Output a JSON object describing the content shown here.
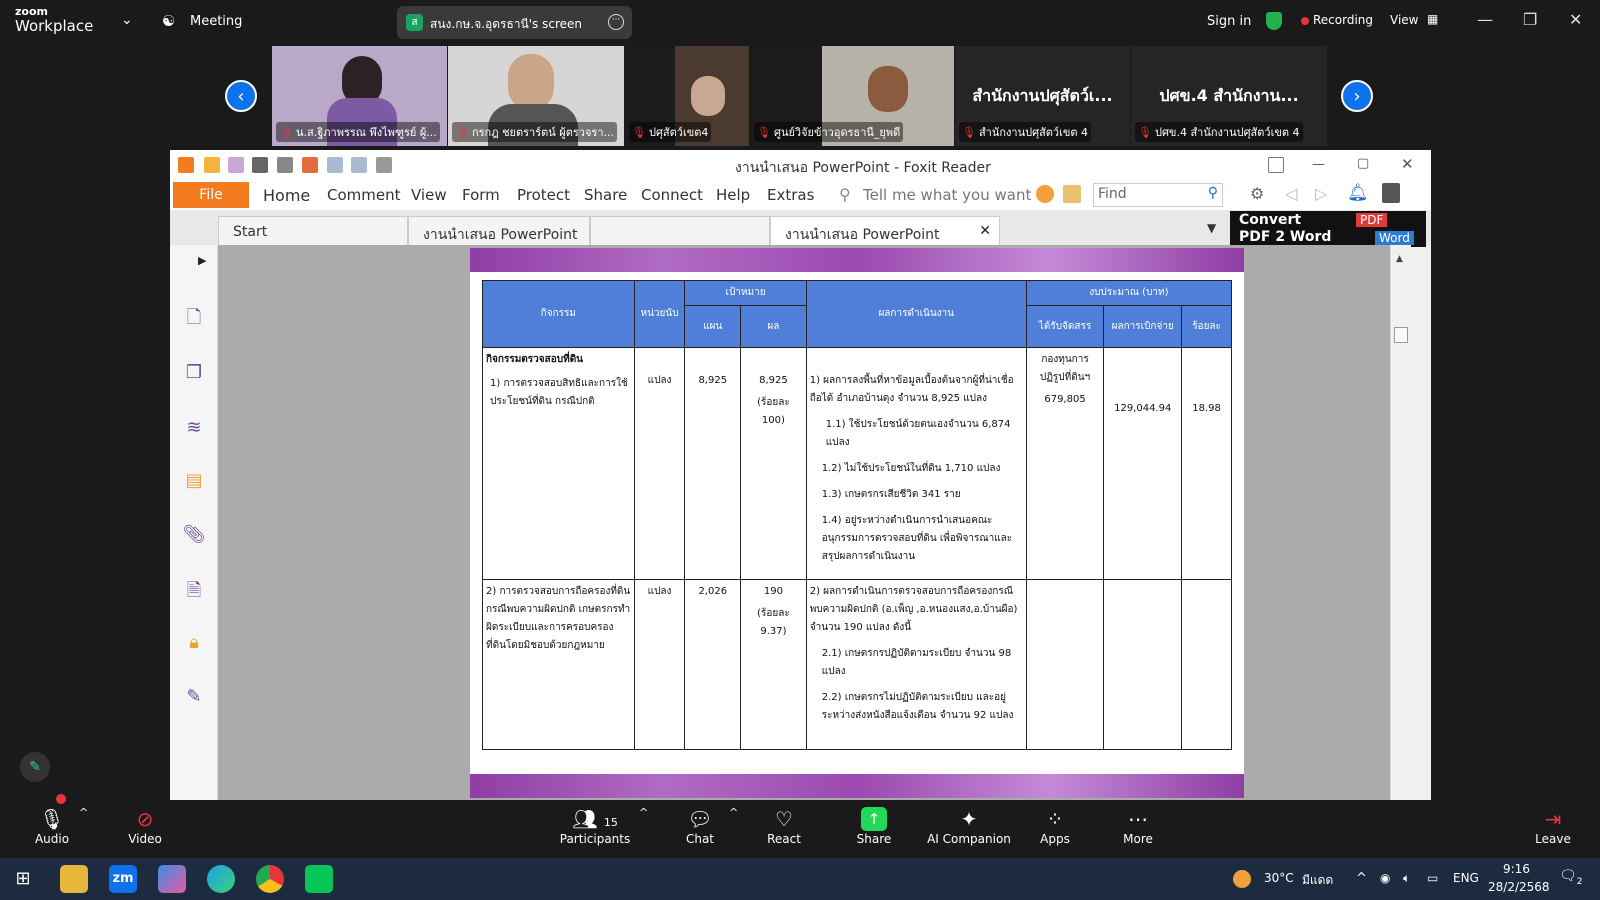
{
  "zoom": {
    "logo_line1": "zoom",
    "logo_line2": "Workplace",
    "meeting_label": "Meeting",
    "share_badge": "ส",
    "share_text": "สนง.กษ.จ.อุดรธานี's screen",
    "sign_in": "Sign in",
    "recording": "Recording",
    "view": "View",
    "participants": [
      {
        "name": "น.ส.ฐิภาพรรณ พึงไพฑูรย์ ผู้...",
        "type": "video"
      },
      {
        "name": "กรกฎ ชยตราร์ตน์ ผู้ตรวจรา...",
        "type": "video"
      },
      {
        "name": "ปศุสัตว์เขต4",
        "type": "video"
      },
      {
        "name": "ศูนย์วิจัยข้าวอุดรธานี_ยุพดี",
        "type": "video"
      },
      {
        "name": "สำนักงานปศุสัตว์เขต 4",
        "display": "สำนักงานปศุสัตว์เ...",
        "type": "text"
      },
      {
        "name": "ปศข.4 สำนักงานปศุสัตว์เขต 4",
        "display": "ปศข.4 สำนักงาน...",
        "type": "text"
      }
    ]
  },
  "foxit": {
    "title": "งานนำเสนอ PowerPoint - Foxit Reader",
    "menu": {
      "file": "File",
      "items": [
        "Home",
        "Comment",
        "View",
        "Form",
        "Protect",
        "Share",
        "Connect",
        "Help",
        "Extras"
      ],
      "tell_me": "Tell me what you want tc",
      "find_placeholder": "Find"
    },
    "tabs": [
      "Start",
      "งานนำเสนอ PowerPoint",
      "",
      "งานนำเสนอ PowerPoint"
    ],
    "convert": {
      "line1": "Convert",
      "line2": "PDF 2 Word",
      "pdf": "PDF",
      "word": "Word"
    }
  },
  "table": {
    "headers": {
      "activity": "กิจกรรม",
      "unit": "หน่วยนับ",
      "target": "เป้าหมาย",
      "plan": "แผน",
      "result": "ผล",
      "performance": "ผลการดำเนินงาน",
      "budget": "งบประมาณ (บาท)",
      "allocated": "ได้รับจัดสรร",
      "disbursed": "ผลการเบิกจ่าย",
      "percent": "ร้อยละ"
    },
    "rows": [
      {
        "section": "กิจกรรมตรวจสอบที่ดิน",
        "activity": "1)    การตรวจสอบสิทธิและการใช้ประโยชน์ที่ดิน กรณีปกติ",
        "unit": "แปลง",
        "plan": "8,925",
        "result": "8,925",
        "result_note": "(ร้อยละ 100)",
        "performance": [
          "1) ผลการลงพื้นที่หาข้อมูลเบื้องต้นจากผู้ที่น่าเชื่อถือได้ อำเภอบ้านดุง จำนวน 8,925 แปลง",
          "1.1) ใช้ประโยชน์ด้วยตนเองจำนวน 6,874 แปลง",
          "1.2) ไม่ใช้ประโยชน์ในที่ดิน 1,710 แปลง",
          "1.3) เกษตรกรเสียชีวิต 341 ราย",
          "1.4) อยู่ระหว่างดำเนินการนำเสนอคณะอนุกรรมการตรวจสอบที่ดิน เพื่อพิจารณาและสรุปผลการดำเนินงาน"
        ],
        "allocated_label": "กองทุนการปฏิรูปที่ดินฯ",
        "allocated": "679,805",
        "disbursed": "129,044.94",
        "percent": "18.98"
      },
      {
        "activity": "2) การตรวจสอบการถือครองที่ดินกรณีพบความผิดปกติ เกษตรกรทำผิดระเบียบและการครอบครองที่ดินโดยมิชอบด้วยกฎหมาย",
        "unit": "แปลง",
        "plan": "2,026",
        "result": "190",
        "result_note": "(ร้อยละ 9.37)",
        "performance": [
          "2) ผลการดำเนินการตรวจสอบการถือครองกรณีพบความผิดปกติ (อ.เพ็ญ ,อ.หนองแสง,อ.บ้านผือ) จำนวน 190 แปลง ดังนี้",
          "2.1) เกษตรกรปฏิบัติตามระเบียบ จำนวน 98 แปลง",
          "2.2) เกษตรกรไม่ปฏิบัติตามระเบียบ และอยู่ระหว่างส่งหนังสือแจ้งเตือน จำนวน 92 แปลง"
        ]
      }
    ]
  },
  "controls": {
    "audio": "Audio",
    "video": "Video",
    "participants": "Participants",
    "participants_count": "15",
    "chat": "Chat",
    "react": "React",
    "share": "Share",
    "ai": "AI Companion",
    "apps": "Apps",
    "more": "More",
    "leave": "Leave"
  },
  "taskbar": {
    "zoom_label": "zm",
    "weather": "30°C",
    "weather_desc": "มีแดด",
    "lang": "ENG",
    "time": "9:16",
    "date": "28/2/2568",
    "notif_count": "2"
  },
  "colors": {
    "zoom_blue": "#0e72ed",
    "foxit_orange": "#f47c20",
    "table_header": "#4f7fd8",
    "share_green": "#23d959"
  }
}
